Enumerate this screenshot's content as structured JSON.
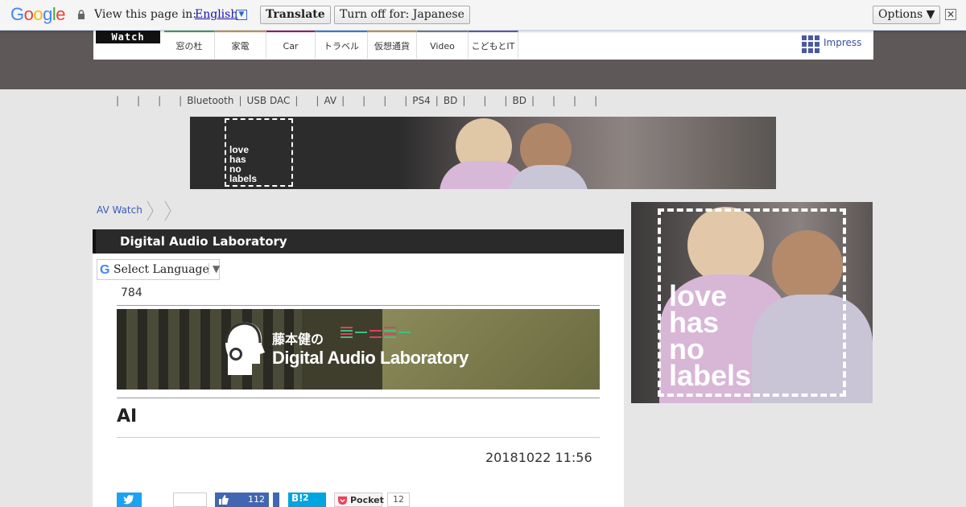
{
  "translate_bar": {
    "logo": "Google",
    "prompt": "View this page in:",
    "language": "English",
    "translate_button": "Translate",
    "turn_off_button": "Turn off for: Japanese",
    "options_button": "Options ▼",
    "close_glyph": "✕"
  },
  "site": {
    "logo": "Watch",
    "tabs": [
      "窓の杜",
      "家電",
      "Car",
      "トラベル",
      "仮想通貨",
      "Video",
      "こどもとIT"
    ],
    "tab_colors": [
      "#4caf50",
      "#e6a23c",
      "#c2185b",
      "#3f8fd6",
      "#e6a23c",
      "#888888",
      "#7b5ea7"
    ],
    "publisher": "Impress"
  },
  "subnav": {
    "items": [
      "",
      "",
      "",
      "",
      "Bluetooth",
      "USB DAC",
      "",
      "AV",
      "",
      "",
      "",
      "PS4",
      "BD",
      "",
      "",
      "BD",
      "",
      "",
      ""
    ]
  },
  "ads": {
    "banner_text": [
      "love",
      "has",
      "no",
      "labels"
    ],
    "side_text": [
      "love",
      "has",
      "no",
      "labels"
    ]
  },
  "breadcrumb": {
    "home": "AV Watch"
  },
  "article": {
    "section_title": "Digital Audio Laboratory",
    "select_language": "Select Language",
    "series_number": "784",
    "series_banner_jp": "藤本健の",
    "series_banner_en": "Digital Audio Laboratory",
    "title": "AI",
    "date": "20181022 11:56"
  },
  "share": {
    "like_count": "112",
    "hatena_label": "B!",
    "hatena_count": "2",
    "pocket_label": "Pocket",
    "pocket_count": "12"
  }
}
